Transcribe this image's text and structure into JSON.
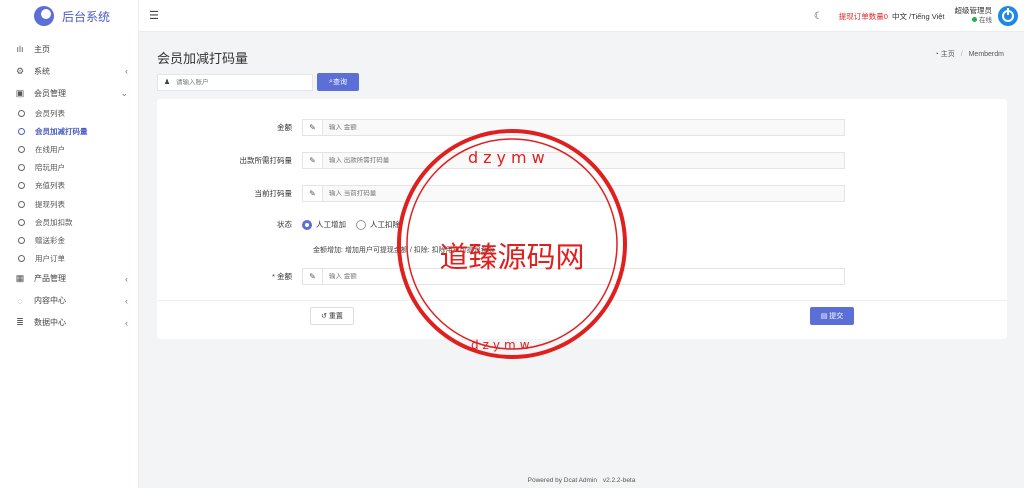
{
  "app": {
    "title": "后台系统"
  },
  "sidebar": {
    "items": [
      {
        "label": "主页",
        "icon": "bar-chart-icon"
      },
      {
        "label": "系统",
        "icon": "gear-icon",
        "arrow": "‹"
      },
      {
        "label": "会员管理",
        "icon": "id-card-icon",
        "arrow": "⌄"
      },
      {
        "label": "产品管理",
        "icon": "grid-icon",
        "arrow": "‹"
      },
      {
        "label": "内容中心",
        "icon": "chat-icon",
        "arrow": "‹"
      },
      {
        "label": "数据中心",
        "icon": "database-icon",
        "arrow": "‹"
      }
    ],
    "sub_items": [
      "会员列表",
      "会员加减打码量",
      "在线用户",
      "陪玩用户",
      "充值列表",
      "提现列表",
      "会员加扣款",
      "赠送彩金",
      "用户订单"
    ]
  },
  "topbar": {
    "orders": "提现订单数量0",
    "lang": "中文 /Tiếng Việt",
    "user_name": "超级管理员",
    "user_status": "在线"
  },
  "page": {
    "title": "会员加减打码量",
    "crumb_home": "主页",
    "crumb_sep": "/",
    "crumb_current": "Memberdm"
  },
  "search": {
    "placeholder": "请输入账户",
    "button": "查询"
  },
  "form": {
    "amount_label": "金额",
    "amount_placeholder": "输入 金额",
    "withdraw_label": "出款所需打码量",
    "withdraw_placeholder": "输入 出款所需打码量",
    "current_label": "当前打码量",
    "current_placeholder": "输入 当前打码量",
    "status_label": "状态",
    "radio_add": "人工增加",
    "radio_deduct": "人工扣除",
    "help": "金额增加: 增加用户可提现金额 / 扣除: 扣除用户可提现金额",
    "req_amount_label": "* 金额",
    "req_amount_placeholder": "输入 金额",
    "reset": "重置",
    "submit": "提交"
  },
  "footer": {
    "powered": "Powered by Dcat Admin",
    "version": "v2.2.2-beta"
  },
  "stamp": {
    "center_text": "道臻源码网",
    "ring_top": "dzymw",
    "ring_bottom": "dzymw"
  },
  "colors": {
    "accent": "#5b6fd6",
    "stamp": "#e01f1f",
    "danger": "#e02424"
  }
}
